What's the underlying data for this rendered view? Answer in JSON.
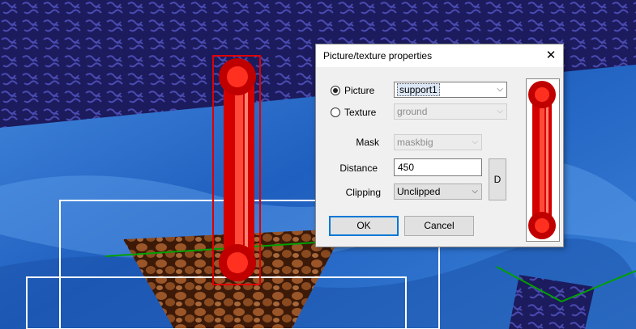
{
  "dialog": {
    "title": "Picture/texture properties",
    "close_glyph": "✕",
    "picture_label": "Picture",
    "picture_value": "support1",
    "picture_selected": true,
    "texture_label": "Texture",
    "texture_value": "ground",
    "mask_label": "Mask",
    "mask_value": "maskbig",
    "distance_label": "Distance",
    "distance_value": "450",
    "clipping_label": "Clipping",
    "clipping_value": "Unclipped",
    "d_button_label": "D",
    "ok_label": "OK",
    "cancel_label": "Cancel",
    "dropdown_icon": "chevron-down-icon",
    "preview_icon": "support-pillar-picture"
  },
  "scene": {
    "sky_color": "#2a6fc9",
    "wall_color": "#1b1b5e",
    "ground_color": "#7a3a16",
    "selection_color": "#e00000",
    "pillar_color": "#d40000"
  }
}
